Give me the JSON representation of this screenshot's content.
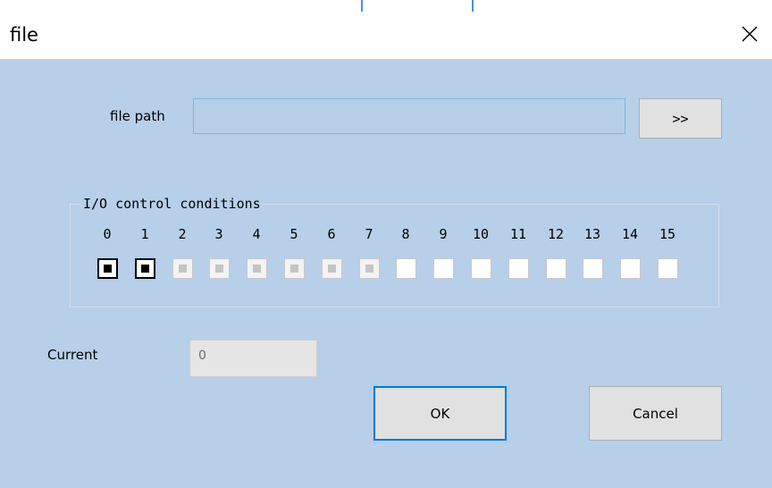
{
  "window": {
    "title": "file"
  },
  "file_path": {
    "label": "file path",
    "value": "",
    "browse_label": ">>"
  },
  "io_group": {
    "title": "I/O control conditions",
    "bits": [
      {
        "label": "0",
        "state": "checked"
      },
      {
        "label": "1",
        "state": "checked"
      },
      {
        "label": "2",
        "state": "indeterminate"
      },
      {
        "label": "3",
        "state": "indeterminate"
      },
      {
        "label": "4",
        "state": "indeterminate"
      },
      {
        "label": "5",
        "state": "indeterminate"
      },
      {
        "label": "6",
        "state": "indeterminate"
      },
      {
        "label": "7",
        "state": "indeterminate"
      },
      {
        "label": "8",
        "state": "unchecked"
      },
      {
        "label": "9",
        "state": "unchecked"
      },
      {
        "label": "10",
        "state": "unchecked"
      },
      {
        "label": "11",
        "state": "unchecked"
      },
      {
        "label": "12",
        "state": "unchecked"
      },
      {
        "label": "13",
        "state": "unchecked"
      },
      {
        "label": "14",
        "state": "unchecked"
      },
      {
        "label": "15",
        "state": "unchecked"
      }
    ]
  },
  "current": {
    "label": "Current",
    "value": "0"
  },
  "buttons": {
    "ok": "OK",
    "cancel": "Cancel"
  },
  "colors": {
    "client_bg": "#b7cfe9",
    "accent": "#0078d7"
  }
}
